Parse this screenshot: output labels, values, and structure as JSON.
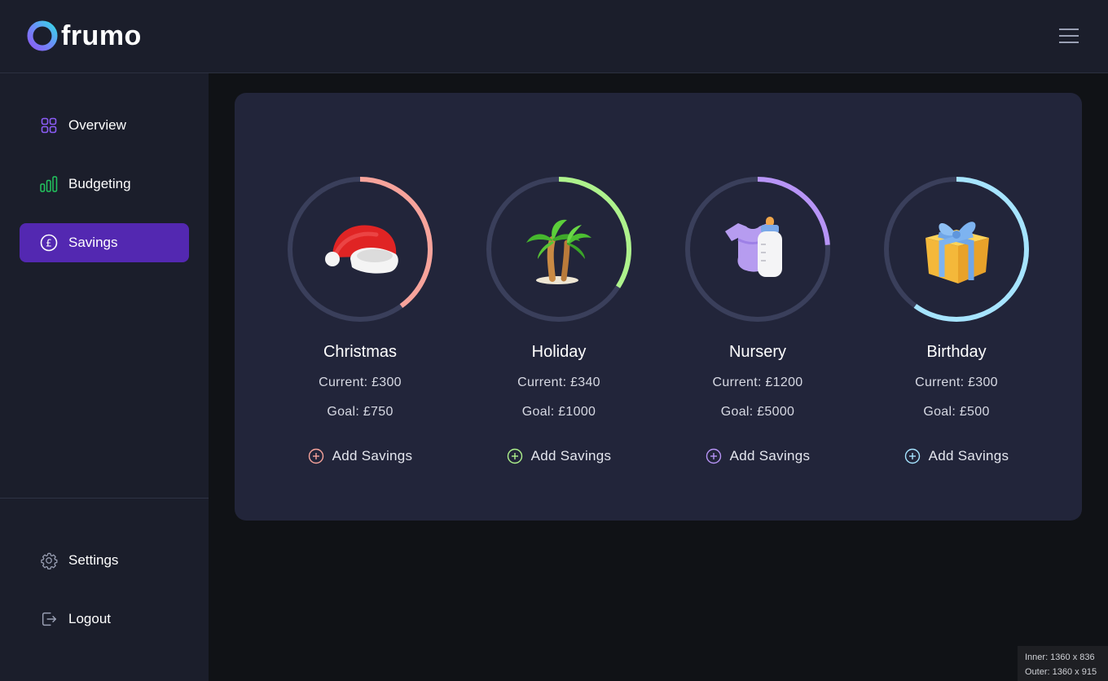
{
  "app": {
    "name": "frumo"
  },
  "header": {
    "menu_icon": "hamburger-menu-icon"
  },
  "sidebar": {
    "items": [
      {
        "label": "Overview",
        "icon": "grid-icon",
        "color": "#8b5cf6",
        "active": false
      },
      {
        "label": "Budgeting",
        "icon": "bar-chart-icon",
        "color": "#22c55e",
        "active": false
      },
      {
        "label": "Savings",
        "icon": "pound-coin-icon",
        "color": "#ffffff",
        "active": true
      }
    ],
    "bottom_items": [
      {
        "label": "Settings",
        "icon": "gear-icon"
      },
      {
        "label": "Logout",
        "icon": "logout-icon"
      }
    ]
  },
  "goals": [
    {
      "name": "Christmas",
      "current": "Current: £300",
      "goal": "Goal: £750",
      "add_label": "Add Savings",
      "progress": 0.4,
      "color": "#f7a39b",
      "icon": "santa-hat-icon"
    },
    {
      "name": "Holiday",
      "current": "Current: £340",
      "goal": "Goal: £1000",
      "add_label": "Add Savings",
      "progress": 0.34,
      "color": "#aef28c",
      "icon": "palm-tree-icon"
    },
    {
      "name": "Nursery",
      "current": "Current: £1200",
      "goal": "Goal: £5000",
      "add_label": "Add Savings",
      "progress": 0.24,
      "color": "#b794f6",
      "icon": "baby-bottle-icon"
    },
    {
      "name": "Birthday",
      "current": "Current: £300",
      "goal": "Goal: £500",
      "add_label": "Add Savings",
      "progress": 0.6,
      "color": "#a6e4ff",
      "icon": "gift-icon"
    }
  ],
  "colors": {
    "ring_track": "#3a3f5b",
    "active_nav": "#5328b1",
    "card_bg": "#22253a"
  },
  "window_info": {
    "inner": "Inner: 1360 x 836",
    "outer": "Outer: 1360 x 915"
  }
}
